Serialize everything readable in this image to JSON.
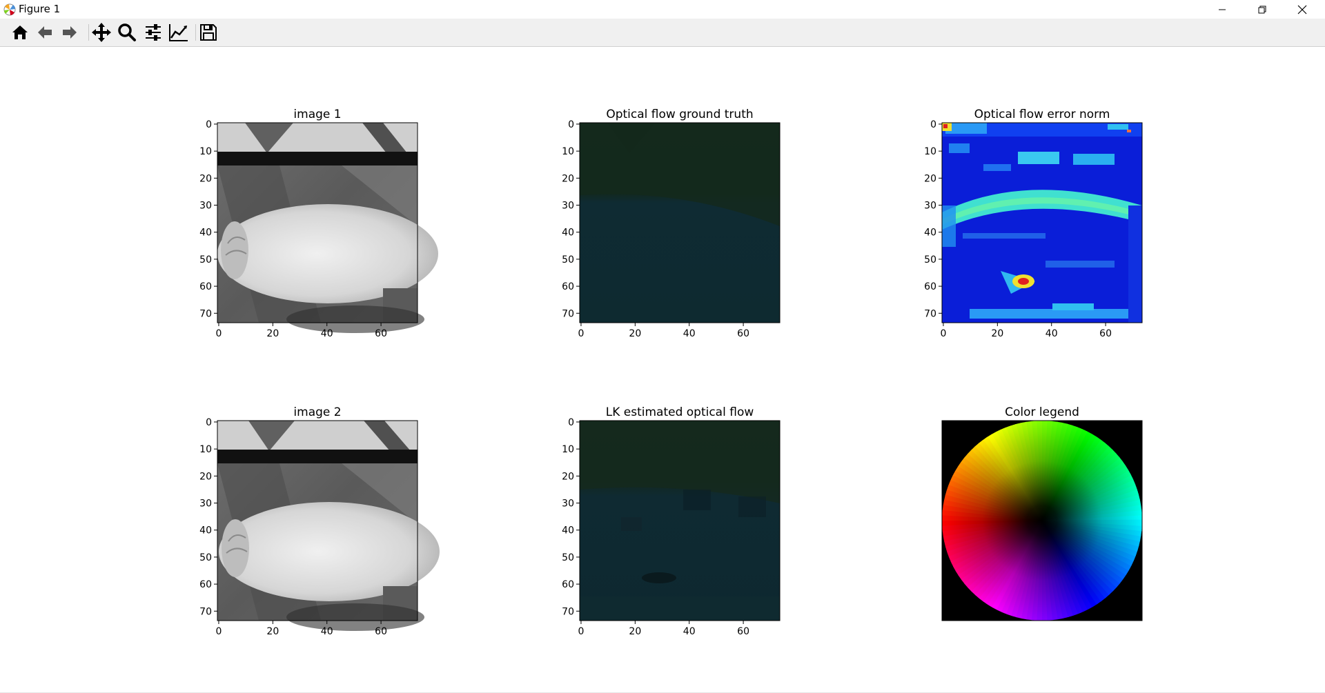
{
  "window": {
    "title": "Figure 1"
  },
  "toolbar": {
    "buttons": [
      {
        "name": "home-icon",
        "tooltip": "Home"
      },
      {
        "name": "back-icon",
        "tooltip": "Back"
      },
      {
        "name": "forward-icon",
        "tooltip": "Forward"
      },
      {
        "name": "pan-icon",
        "tooltip": "Pan"
      },
      {
        "name": "zoom-icon",
        "tooltip": "Zoom"
      },
      {
        "name": "subplots-icon",
        "tooltip": "Configure subplots"
      },
      {
        "name": "edit-axis-icon",
        "tooltip": "Edit axis"
      },
      {
        "name": "save-icon",
        "tooltip": "Save"
      }
    ]
  },
  "chart_data": [
    {
      "type": "heatmap",
      "title": "image 1",
      "colormap": "gray",
      "xticks": [
        "0",
        "20",
        "40",
        "60"
      ],
      "yticks": [
        "0",
        "10",
        "20",
        "30",
        "40",
        "50",
        "60",
        "70"
      ],
      "xlim": [
        0,
        74
      ],
      "ylim": [
        74,
        0
      ]
    },
    {
      "type": "heatmap",
      "title": "Optical flow ground truth",
      "colormap": "hsv-flow",
      "xticks": [
        "0",
        "20",
        "40",
        "60"
      ],
      "yticks": [
        "0",
        "10",
        "20",
        "30",
        "40",
        "50",
        "60",
        "70"
      ],
      "xlim": [
        0,
        74
      ],
      "ylim": [
        74,
        0
      ]
    },
    {
      "type": "heatmap",
      "title": "Optical flow error norm",
      "colormap": "jet",
      "xticks": [
        "0",
        "20",
        "40",
        "60"
      ],
      "yticks": [
        "0",
        "10",
        "20",
        "30",
        "40",
        "50",
        "60",
        "70"
      ],
      "xlim": [
        0,
        74
      ],
      "ylim": [
        74,
        0
      ]
    },
    {
      "type": "heatmap",
      "title": "image 2",
      "colormap": "gray",
      "xticks": [
        "0",
        "20",
        "40",
        "60"
      ],
      "yticks": [
        "0",
        "10",
        "20",
        "30",
        "40",
        "50",
        "60",
        "70"
      ],
      "xlim": [
        0,
        74
      ],
      "ylim": [
        74,
        0
      ]
    },
    {
      "type": "heatmap",
      "title": "LK estimated optical flow",
      "colormap": "hsv-flow",
      "xticks": [
        "0",
        "20",
        "40",
        "60"
      ],
      "yticks": [
        "0",
        "10",
        "20",
        "30",
        "40",
        "50",
        "60",
        "70"
      ],
      "xlim": [
        0,
        74
      ],
      "ylim": [
        74,
        0
      ]
    },
    {
      "type": "heatmap",
      "title": "Color legend",
      "colormap": "hsv-wheel",
      "xticks": [],
      "yticks": []
    }
  ]
}
